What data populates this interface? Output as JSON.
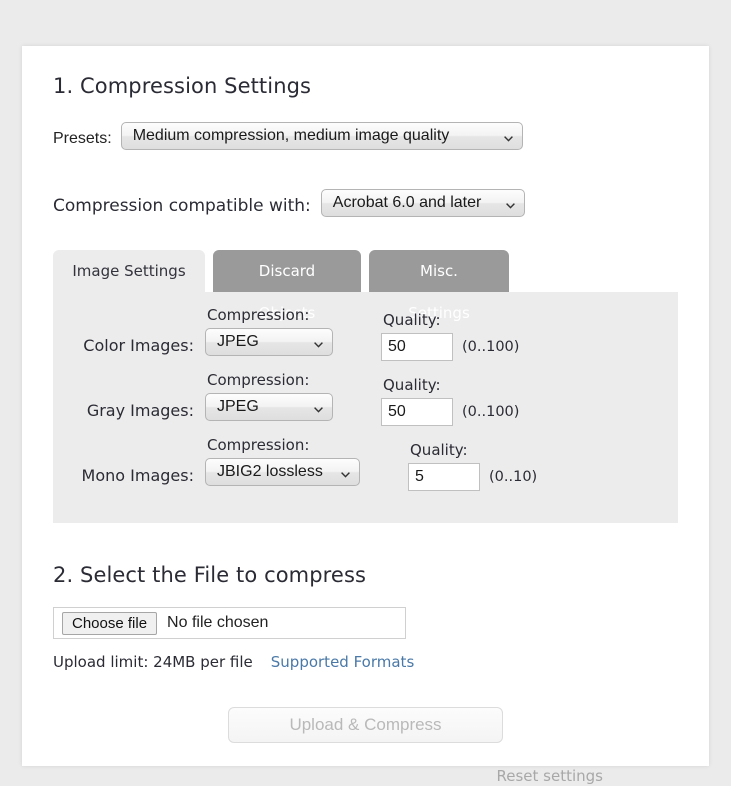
{
  "sections": {
    "compression": {
      "title": "1. Compression Settings",
      "presets": {
        "label": "Presets:",
        "value": "Medium compression, medium image quality"
      },
      "compatibility": {
        "label": "Compression compatible with:",
        "value": "Acrobat 6.0 and later"
      },
      "tabs": [
        {
          "label": "Image Settings",
          "active": true
        },
        {
          "label": "Discard Objects",
          "active": false
        },
        {
          "label": "Misc. Settings",
          "active": false
        }
      ],
      "captions": {
        "compression": "Compression:",
        "quality": "Quality:"
      },
      "rows": [
        {
          "label": "Color Images:",
          "compression_value": "JPEG",
          "quality_value": "50",
          "quality_range": "(0..100)"
        },
        {
          "label": "Gray Images:",
          "compression_value": "JPEG",
          "quality_value": "50",
          "quality_range": "(0..100)"
        },
        {
          "label": "Mono Images:",
          "compression_value": "JBIG2 lossless",
          "quality_value": "5",
          "quality_range": "(0..10)"
        }
      ]
    },
    "file": {
      "title": "2. Select the File to compress",
      "choose_button": "Choose file",
      "file_status": "No file chosen",
      "upload_limit": "Upload limit: 24MB per file",
      "supported_formats_link": "Supported Formats"
    },
    "actions": {
      "upload_button": "Upload & Compress",
      "reset_link": "Reset settings"
    }
  },
  "colors": {
    "page_background": "#ebebeb",
    "card_background": "#ffffff",
    "panel_background": "#ececec",
    "tab_inactive": "#9a9a9a",
    "link": "#4a79a8",
    "disabled_text": "#b9b9b9"
  }
}
